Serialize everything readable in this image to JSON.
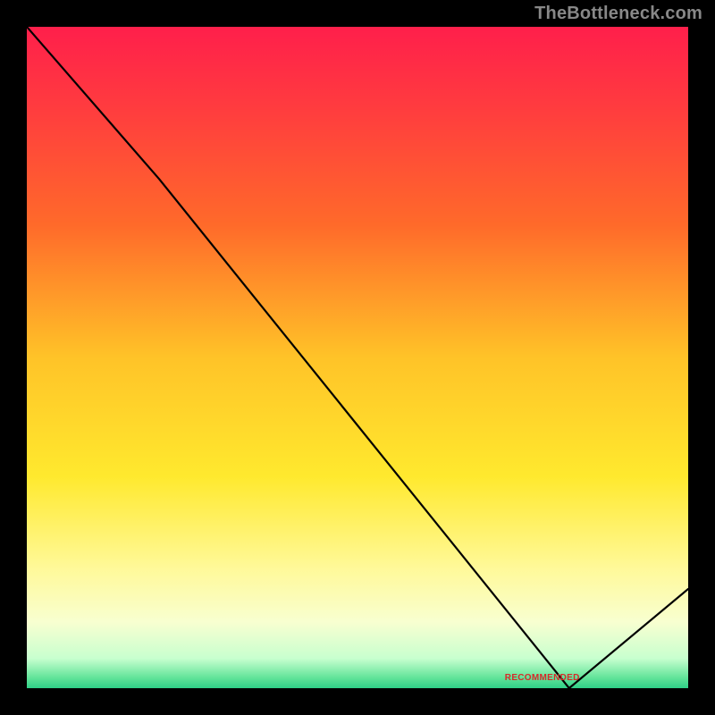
{
  "watermark": "TheBottleneck.com",
  "chart_data": {
    "type": "line",
    "title": "",
    "xlabel": "",
    "ylabel": "",
    "xlim": [
      0,
      100
    ],
    "ylim": [
      0,
      100
    ],
    "values": [
      {
        "x": 0,
        "y": 100
      },
      {
        "x": 20,
        "y": 77
      },
      {
        "x": 82,
        "y": 0
      },
      {
        "x": 100,
        "y": 15
      }
    ],
    "annotations": [
      {
        "text_ref": "annotation_text",
        "x": 77,
        "y": 1.5
      }
    ],
    "gradient_stops": [
      {
        "offset": 0,
        "color": "#ff1f4b"
      },
      {
        "offset": 0.12,
        "color": "#ff3b3f"
      },
      {
        "offset": 0.3,
        "color": "#ff6a2a"
      },
      {
        "offset": 0.5,
        "color": "#ffc328"
      },
      {
        "offset": 0.68,
        "color": "#ffe92e"
      },
      {
        "offset": 0.82,
        "color": "#fff99a"
      },
      {
        "offset": 0.9,
        "color": "#f8ffd0"
      },
      {
        "offset": 0.955,
        "color": "#c8ffcf"
      },
      {
        "offset": 0.985,
        "color": "#5fe398"
      },
      {
        "offset": 1.0,
        "color": "#2fcf87"
      }
    ]
  },
  "annotation_text": "RECOMMENDED"
}
